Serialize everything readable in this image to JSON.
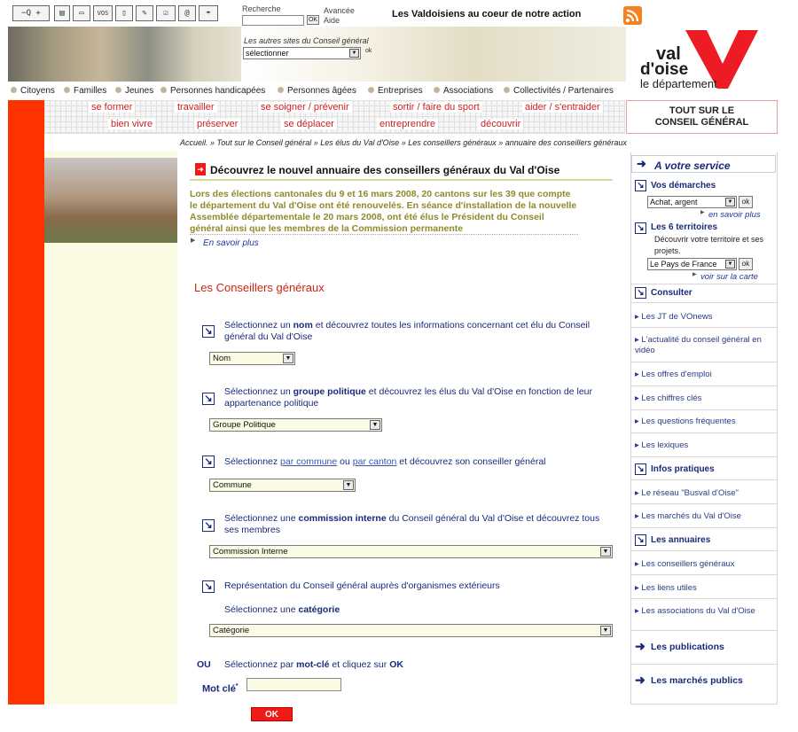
{
  "toolbar": {
    "zoom_out": "−Q",
    "zoom_in": "+",
    "vos_label": "VOS",
    "search_label": "Recherche",
    "search_ok": "OK",
    "advanced_label": "Avancée",
    "help_label": "Aide",
    "slogan": "Les Valdoisiens au coeur de notre action"
  },
  "banner": {
    "other_sites_label": "Les autres sites du Conseil général",
    "other_sites_select": "sélectionner",
    "other_sites_ok": "ok",
    "logo_line1": "val",
    "logo_line2": "d'oise",
    "logo_line3": "le département"
  },
  "nav": [
    "Citoyens",
    "Familles",
    "Jeunes",
    "Personnes handicapées",
    "Personnes âgées",
    "Entreprises",
    "Associations",
    "Collectivités / Partenaires"
  ],
  "actions_row1": [
    "se former",
    "travailler",
    "se soigner / prévenir",
    "sortir / faire du sport",
    "aider / s'entraider"
  ],
  "actions_row2": [
    "bien vivre",
    "préserver",
    "se déplacer",
    "entreprendre",
    "découvrir"
  ],
  "tout_sur": "TOUT SUR LE CONSEIL GÉNÉRAL",
  "breadcrumb": "Accueil. » Tout sur le Conseil général » Les élus du Val d'Oise » Les conseillers généraux » annuaire des conseillers généraux",
  "main": {
    "headline": "Découvrez le nouvel annuaire des conseillers généraux du Val d'Oise",
    "intro": "Lors des élections cantonales du 9 et 16 mars 2008, 20 cantons sur les 39 que compte le département du Val d'Oise ont été renouvelés. En séance d'installation de la nouvelle Assemblée départementale le 20 mars 2008, ont été élus le Président du Conseil général ainsi que les membres de la Commission permanente",
    "more_link": "En savoir plus",
    "section_title": "Les Conseillers généraux",
    "s1_pre": "Sélectionnez un ",
    "s1_bold": "nom",
    "s1_post": " et découvrez toutes les informations concernant cet élu du Conseil général du Val d'Oise",
    "s1_select": "Nom",
    "s2_pre": "Sélectionnez un ",
    "s2_bold": "groupe politique",
    "s2_post": " et découvrez les élus du Val d'Oise en fonction de leur appartenance politique",
    "s2_select": "Groupe Politique",
    "s3_pre": "Sélectionnez ",
    "s3_link1": "par commune",
    "s3_mid": " ou ",
    "s3_link2": "par canton",
    "s3_post": " et découvrez son conseiller général",
    "s3_select": "Commune",
    "s4_pre": "Sélectionnez une ",
    "s4_bold": "commission interne",
    "s4_post": " du Conseil général du Val d'Oise et découvrez tous ses membres",
    "s4_select": "Commission Interne",
    "s5_line1": "Représentation du Conseil général auprès d'organismes extérieurs",
    "s5_pre": "Sélectionnez une ",
    "s5_bold": "catégorie",
    "s5_select": "Catégorie",
    "ou": "OU",
    "s6_pre": "Sélectionnez par ",
    "s6_bold": "mot-clé",
    "s6_mid": " et cliquez sur ",
    "s6_bold2": "OK",
    "keyword_label": "Mot clé",
    "keyword_sup": "*",
    "ok_button": "OK"
  },
  "right": {
    "header": "A votre service",
    "demarches": "Vos démarches",
    "demarches_select": "Achat, argent",
    "ok": "ok",
    "demarches_more": "en savoir plus",
    "territoires": "Les 6 territoires",
    "territoires_desc": "Découvrir votre territoire et ses projets.",
    "territoires_select": "Le Pays de France",
    "territoires_more": "voir sur la carte",
    "consulter": "Consulter",
    "consulter_links": [
      "Les JT de VOnews",
      "L'actualité du conseil général en vidéo",
      "Les offres d'emploi",
      "Les chiffres clés",
      "Les questions fréquentes",
      "Les lexiques"
    ],
    "infos": "Infos pratiques",
    "infos_links": [
      "Le réseau \"Busval d'Oise\"",
      "Les marchés du Val d'Oise"
    ],
    "annuaires": "Les annuaires",
    "annuaires_links": [
      "Les conseillers généraux",
      "Les liens utiles",
      "Les associations du Val d'Oise"
    ],
    "publications": "Les publications",
    "marches": "Les marchés publics"
  },
  "colors": {
    "brand_red": "#ff3300",
    "link_blue": "#1a2a7a",
    "intro_olive": "#8f8b2a",
    "title_red": "#d0230f"
  }
}
